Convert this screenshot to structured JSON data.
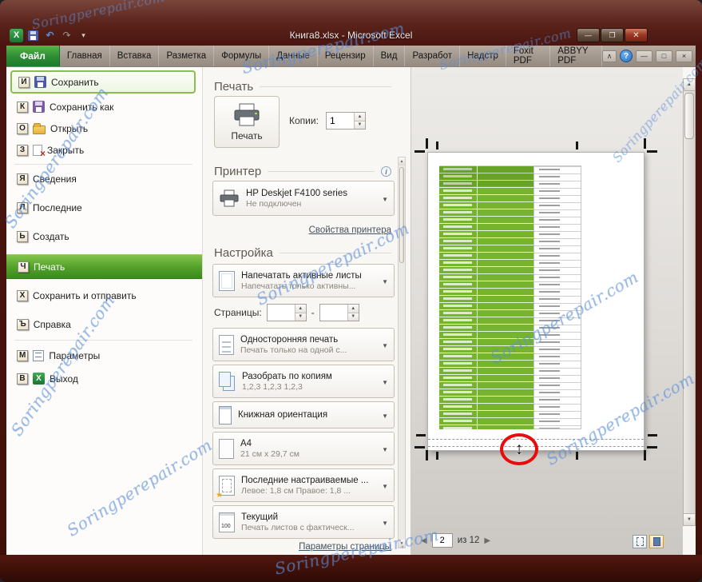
{
  "window": {
    "title": "Книга8.xlsx - Microsoft Excel",
    "watermark": "Soringperepair.com"
  },
  "ribbon": {
    "file_tab": "Файл",
    "tabs": [
      "Главная",
      "Вставка",
      "Разметка",
      "Формулы",
      "Данные",
      "Рецензир",
      "Вид",
      "Разработ",
      "Надстр",
      "Foxit PDF",
      "ABBYY PDF"
    ]
  },
  "sidebar": {
    "items": [
      {
        "key": "И",
        "label": "Сохранить",
        "icon": "save-icon"
      },
      {
        "key": "К",
        "label": "Сохранить как",
        "icon": "save-as-icon"
      },
      {
        "key": "О",
        "label": "Открыть",
        "icon": "open-folder-icon"
      },
      {
        "key": "З",
        "label": "Закрыть",
        "icon": "close-document-icon"
      },
      {
        "key": "Я",
        "label": "Сведения"
      },
      {
        "key": "Л",
        "label": "Последние"
      },
      {
        "key": "Ь",
        "label": "Создать"
      },
      {
        "key": "Ч",
        "label": "Печать",
        "selected": true
      },
      {
        "key": "Х",
        "label": "Сохранить и отправить"
      },
      {
        "key": "Ъ",
        "label": "Справка"
      },
      {
        "key": "М",
        "label": "Параметры",
        "icon": "options-icon"
      },
      {
        "key": "В",
        "label": "Выход",
        "icon": "exit-icon"
      }
    ]
  },
  "print": {
    "header": "Печать",
    "button_label": "Печать",
    "copies_label": "Копии:",
    "copies_value": "1"
  },
  "printer": {
    "header": "Принтер",
    "name": "HP Deskjet F4100 series",
    "status": "Не подключен",
    "properties": "Свойства принтера"
  },
  "settings": {
    "header": "Настройка",
    "pages_label": "Страницы:",
    "pages_dash": "-",
    "rows": [
      {
        "title": "Напечатать активные листы",
        "subtitle": "Напечатать только активны...",
        "icon": "active-sheets-icon"
      },
      {
        "title": "Односторонняя печать",
        "subtitle": "Печать только на одной с...",
        "icon": "one-sided-icon"
      },
      {
        "title": "Разобрать по копиям",
        "subtitle": "1,2,3    1,2,3    1,2,3",
        "icon": "collate-icon"
      },
      {
        "title": "Книжная ориентация",
        "subtitle": "",
        "icon": "portrait-icon"
      },
      {
        "title": "A4",
        "subtitle": "21 см x 29,7 см",
        "icon": "paper-size-icon"
      },
      {
        "title": "Последние настраиваемые ...",
        "subtitle": "Левое: 1,8 см   Правое: 1,8 ...",
        "icon": "margins-icon"
      },
      {
        "title": "Текущий",
        "subtitle": "Печать листов с фактическ...",
        "icon": "scaling-icon"
      }
    ],
    "page_setup": "Параметры страницы"
  },
  "preview": {
    "page_value": "2",
    "of_label": "из 12"
  }
}
